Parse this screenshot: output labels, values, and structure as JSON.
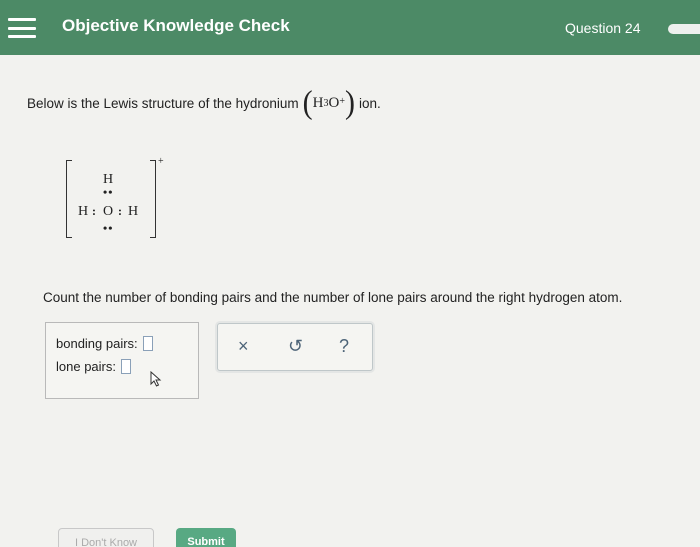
{
  "header": {
    "title": "Objective Knowledge Check",
    "question_label": "Question 24"
  },
  "prompt": {
    "text": "Below is the Lewis structure of the hydronium",
    "formula_h": "H",
    "formula_sub": "3",
    "formula_o": "O",
    "formula_sup": "+",
    "ion_word": "ion."
  },
  "lewis": {
    "top_h": "H",
    "left_h": "H",
    "center_o": "O",
    "right_h": "H",
    "charge": "+",
    "pair_top": "••",
    "pair_bottom": "••",
    "pair_left": ":",
    "pair_right": ":"
  },
  "instruction": "Count the number of bonding pairs and the number of lone pairs around the right hydrogen atom.",
  "answer": {
    "bonding_label": "bonding pairs:",
    "bonding_value": "",
    "lone_label": "lone pairs:",
    "lone_value": ""
  },
  "tools": {
    "clear": "×",
    "undo": "↺",
    "help": "?"
  },
  "buttons": {
    "dont_know": "I Don't Know",
    "submit": "Submit"
  },
  "colors": {
    "header": "#4c8a66",
    "submit": "#58a983",
    "tool_icons": "#4d6478"
  },
  "icons": [
    "menu-icon",
    "clear-icon",
    "undo-icon",
    "help-icon",
    "cursor-icon"
  ]
}
